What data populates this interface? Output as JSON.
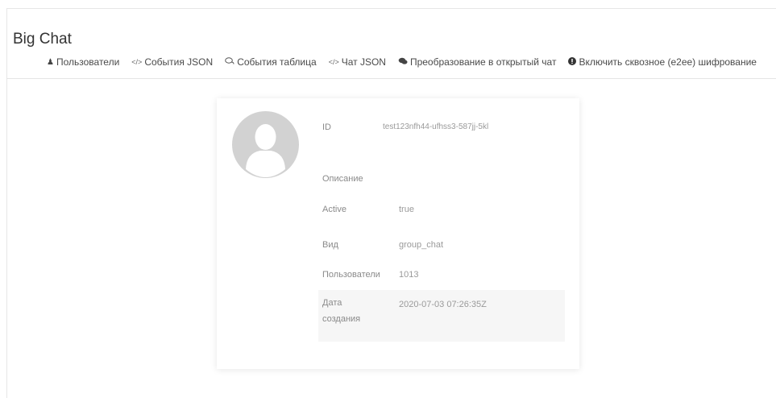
{
  "page": {
    "title": "Big Chat"
  },
  "nav": {
    "items": [
      {
        "label": "Пользователи",
        "icon": "user-icon"
      },
      {
        "label": "События JSON",
        "icon": "code-icon"
      },
      {
        "label": "События таблица",
        "icon": "comments-icon"
      },
      {
        "label": "Чат JSON",
        "icon": "code-icon"
      },
      {
        "label": "Преобразование в открытый чат",
        "icon": "chat-icon"
      },
      {
        "label": "Включить сквозное (e2ee) шифрование",
        "icon": "info-circle-icon"
      }
    ]
  },
  "card": {
    "avatar_icon": "avatar-placeholder-icon",
    "rows": [
      {
        "label": "ID",
        "value": "test123nfh44-ufhss3-587jj-5kl"
      },
      {
        "label": "Описание",
        "value": ""
      },
      {
        "label": "Active",
        "value": "true"
      },
      {
        "label": "Вид",
        "value": "group_chat"
      },
      {
        "label": "Пользователи",
        "value": "1013"
      },
      {
        "label": "Дата создания",
        "value": "2020-07-03 07:26:35Z"
      }
    ]
  },
  "colors": {
    "text": "#333333",
    "muted": "#8a8a8a",
    "highlight_row": "#f6f6f6",
    "avatar": "#d2d2d2"
  }
}
